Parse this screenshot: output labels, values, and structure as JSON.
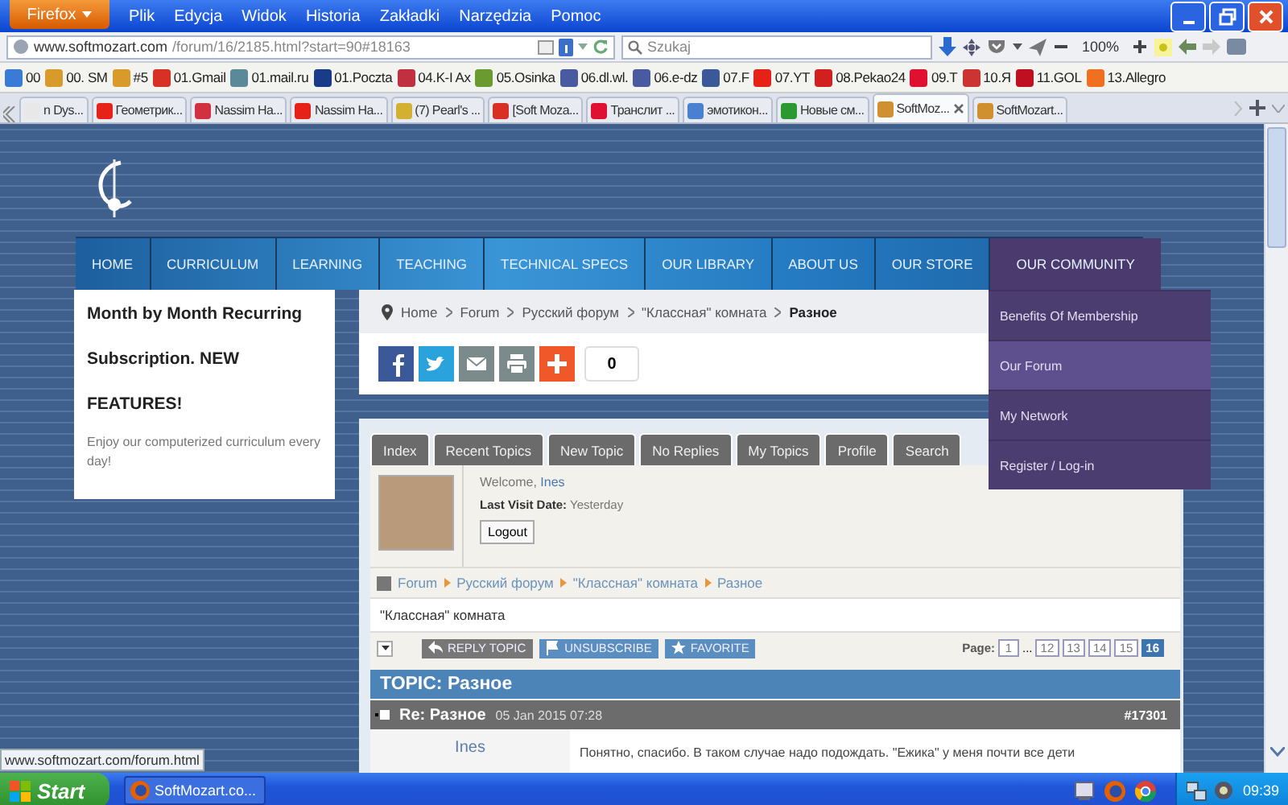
{
  "window": {
    "app_button": "Firefox",
    "menu": [
      "Plik",
      "Edycja",
      "Widok",
      "Historia",
      "Zakładki",
      "Narzędzia",
      "Pomoc"
    ]
  },
  "address_bar": {
    "domain": "www.softmozart.com",
    "path": "/forum/16/2185.html?start=90#18163"
  },
  "search": {
    "placeholder": "Szukaj"
  },
  "zoom_level": "100%",
  "bookmarks": [
    {
      "label": "00",
      "color": "#3a7bd5"
    },
    {
      "label": "00. SM",
      "color": "#d89a2a"
    },
    {
      "label": "#5",
      "color": "#d89a2a"
    },
    {
      "label": "01.Gmail",
      "color": "#d93025"
    },
    {
      "label": "01.mail.ru",
      "color": "#5a8a9a"
    },
    {
      "label": "01.Poczta",
      "color": "#1a3a8a"
    },
    {
      "label": "04.K-I Ax",
      "color": "#c03040"
    },
    {
      "label": "05.Osinka",
      "color": "#6a9a30"
    },
    {
      "label": "06.dl.wl.",
      "color": "#4a5aa0"
    },
    {
      "label": "06.e-dz",
      "color": "#4a5aa0"
    },
    {
      "label": "07.F",
      "color": "#3b5998"
    },
    {
      "label": "07.YT",
      "color": "#e62117"
    },
    {
      "label": "08.Pekao24",
      "color": "#d02020"
    },
    {
      "label": "09.T",
      "color": "#e01030"
    },
    {
      "label": "10.Я",
      "color": "#cc3333"
    },
    {
      "label": "11.GOL",
      "color": "#c01020"
    },
    {
      "label": "13.Allegro",
      "color": "#f07020"
    }
  ],
  "tabs": [
    {
      "label": "n Dys...",
      "selected": false,
      "color": "#e8e8e8"
    },
    {
      "label": "Геометрик...",
      "selected": false,
      "color": "#e62117"
    },
    {
      "label": "Nassim Ha...",
      "selected": false,
      "color": "#d03040"
    },
    {
      "label": "Nassim Ha...",
      "selected": false,
      "color": "#e62117"
    },
    {
      "label": "(7) Pearl's ...",
      "selected": false,
      "color": "#d4b030"
    },
    {
      "label": "[Soft Moza...",
      "selected": false,
      "color": "#d93025"
    },
    {
      "label": "Транслит ...",
      "selected": false,
      "color": "#e01030"
    },
    {
      "label": "эмотикон...",
      "selected": false,
      "color": "#4a80d0"
    },
    {
      "label": "Новые см...",
      "selected": false,
      "color": "#2a9a30"
    },
    {
      "label": "SoftMoz...",
      "selected": true,
      "color": "#d09030"
    },
    {
      "label": "SoftMozart...",
      "selected": false,
      "color": "#d09030"
    }
  ],
  "site_nav": [
    {
      "label": "HOME",
      "selected": false
    },
    {
      "label": "CURRICULUM",
      "selected": false
    },
    {
      "label": "LEARNING",
      "selected": false
    },
    {
      "label": "TEACHING",
      "selected": false
    },
    {
      "label": "TECHNICAL SPECS",
      "selected": false
    },
    {
      "label": "OUR LIBRARY",
      "selected": false
    },
    {
      "label": "ABOUT US",
      "selected": false
    },
    {
      "label": "OUR STORE",
      "selected": false
    },
    {
      "label": "OUR COMMUNITY",
      "selected": true
    }
  ],
  "community_menu": [
    {
      "label": "Benefits Of Membership",
      "selected": false
    },
    {
      "label": "Our Forum",
      "selected": true
    },
    {
      "label": "My Network",
      "selected": false
    },
    {
      "label": "Register / Log-in",
      "selected": false
    }
  ],
  "promo": {
    "heading": "Month by Month Recurring Subscription. NEW FEATURES!",
    "text": "Enjoy our computerized curriculum every day!"
  },
  "breadcrumb": [
    "Home",
    "Forum",
    "Русский форум",
    "\"Классная\" комната",
    "Разное"
  ],
  "share": {
    "buttons": [
      {
        "kind": "facebook"
      },
      {
        "kind": "twitter"
      },
      {
        "kind": "email"
      },
      {
        "kind": "print"
      },
      {
        "kind": "plus"
      }
    ],
    "count": "0"
  },
  "forum_tabs": [
    "Index",
    "Recent Topics",
    "New Topic",
    "No Replies",
    "My Topics",
    "Profile",
    "Search"
  ],
  "user": {
    "welcome": "Welcome,",
    "name": "Ines",
    "last_visit_label": "Last Visit Date:",
    "last_visit": "Yesterday",
    "logout": "Logout"
  },
  "forum_path": [
    "Forum",
    "Русский форум",
    "\"Классная\" комната",
    "Разное"
  ],
  "category": "\"Классная\" комната",
  "actions": [
    {
      "label": "REPLY TOPIC",
      "kind": "reply"
    },
    {
      "label": "UNSUBSCRIBE",
      "kind": "unsubscribe"
    },
    {
      "label": "FAVORITE",
      "kind": "favorite"
    }
  ],
  "pagination": {
    "label": "Page:",
    "pages": [
      {
        "label": "1",
        "kind": "page",
        "selected": false
      },
      {
        "label": "...",
        "kind": "gap"
      },
      {
        "label": "12",
        "kind": "page",
        "selected": false
      },
      {
        "label": "13",
        "kind": "page",
        "selected": false
      },
      {
        "label": "14",
        "kind": "page",
        "selected": false
      },
      {
        "label": "15",
        "kind": "page",
        "selected": false
      },
      {
        "label": "16",
        "kind": "page",
        "selected": true
      }
    ]
  },
  "topic": "TOPIC: Разное",
  "post": {
    "title": "Re: Разное",
    "date": "05 Jan 2015 07:28",
    "number": "#17301",
    "author": "Ines",
    "text": "Понятно, спасибо. В таком случае надо подождать. \"Ежика\" у меня почти все дети"
  },
  "status_url": "www.softmozart.com/forum.html",
  "taskbar": {
    "start": "Start",
    "task": "SoftMozart.co...",
    "clock": "09:39"
  }
}
